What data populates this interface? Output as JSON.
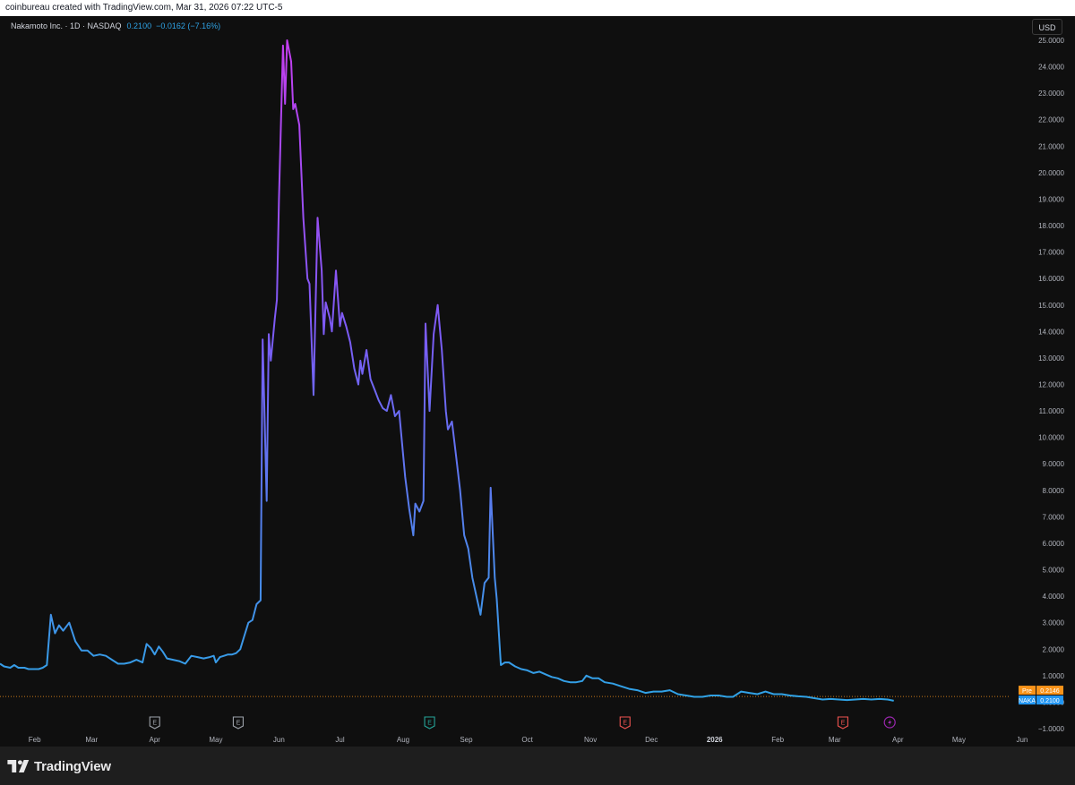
{
  "header": {
    "caption": "coinbureau created with TradingView.com, Mar 31, 2026 07:22 UTC-5"
  },
  "legend": {
    "symbol": "Nakamoto Inc. · 1D · NASDAQ",
    "last": "0.2100",
    "change": "−0.0162 (−7.16%)"
  },
  "currency_button": "USD",
  "price_tags": {
    "pre_label": "Pre",
    "pre_value": "0.2146",
    "pre_color": "#f7931a",
    "ticker_label": "NAKA",
    "ticker_value": "0.2100",
    "ticker_color": "#2196f3"
  },
  "colors": {
    "background": "#0f0f0f",
    "line_low": "#2fa3e5",
    "line_high": "#c43ef0",
    "prepost_line": "#f7931a"
  },
  "events": [
    {
      "date": "2025-04-01",
      "icon": "earnings-icon",
      "label": "E",
      "color": "#9ea3ab"
    },
    {
      "date": "2025-05-12",
      "icon": "earnings-icon",
      "label": "E",
      "color": "#9ea3ab"
    },
    {
      "date": "2025-08-14",
      "icon": "earnings-icon",
      "label": "E",
      "color": "#26a69a"
    },
    {
      "date": "2025-11-18",
      "icon": "earnings-icon",
      "label": "E",
      "color": "#ef5350"
    },
    {
      "date": "2026-03-05",
      "icon": "earnings-icon",
      "label": "E",
      "color": "#ef5350"
    },
    {
      "date": "2026-03-28",
      "icon": "lightning-icon",
      "label": "",
      "color": "#9c27b0"
    }
  ],
  "footer": {
    "brand": "TradingView"
  },
  "chart_data": {
    "type": "line",
    "title": "",
    "xlabel": "",
    "ylabel": "",
    "currency": "USD",
    "x_range": [
      "2025-01-15",
      "2026-06-05"
    ],
    "ylim": [
      -1.0,
      25.0
    ],
    "y_ticks": [
      -1,
      0,
      1,
      2,
      3,
      4,
      5,
      6,
      7,
      8,
      9,
      10,
      11,
      12,
      13,
      14,
      15,
      16,
      17,
      18,
      19,
      20,
      21,
      22,
      23,
      24,
      25
    ],
    "y_tick_labels": [
      "−1.0000",
      "0.0000",
      "1.0000",
      "2.0000",
      "3.0000",
      "4.0000",
      "5.0000",
      "6.0000",
      "7.0000",
      "8.0000",
      "9.0000",
      "10.0000",
      "11.0000",
      "12.0000",
      "13.0000",
      "14.0000",
      "15.0000",
      "16.0000",
      "17.0000",
      "18.0000",
      "19.0000",
      "20.0000",
      "21.0000",
      "22.0000",
      "23.0000",
      "24.0000",
      "25.0000"
    ],
    "x_ticks": [
      {
        "date": "2025-02-01",
        "label": "Feb",
        "bold": false
      },
      {
        "date": "2025-03-01",
        "label": "Mar",
        "bold": false
      },
      {
        "date": "2025-04-01",
        "label": "Apr",
        "bold": false
      },
      {
        "date": "2025-05-01",
        "label": "May",
        "bold": false
      },
      {
        "date": "2025-06-01",
        "label": "Jun",
        "bold": false
      },
      {
        "date": "2025-07-01",
        "label": "Jul",
        "bold": false
      },
      {
        "date": "2025-08-01",
        "label": "Aug",
        "bold": false
      },
      {
        "date": "2025-09-01",
        "label": "Sep",
        "bold": false
      },
      {
        "date": "2025-10-01",
        "label": "Oct",
        "bold": false
      },
      {
        "date": "2025-11-01",
        "label": "Nov",
        "bold": false
      },
      {
        "date": "2025-12-01",
        "label": "Dec",
        "bold": false
      },
      {
        "date": "2026-01-01",
        "label": "2026",
        "bold": true
      },
      {
        "date": "2026-02-01",
        "label": "Feb",
        "bold": false
      },
      {
        "date": "2026-03-01",
        "label": "Mar",
        "bold": false
      },
      {
        "date": "2026-04-01",
        "label": "Apr",
        "bold": false
      },
      {
        "date": "2026-05-01",
        "label": "May",
        "bold": false
      },
      {
        "date": "2026-06-01",
        "label": "Jun",
        "bold": false
      }
    ],
    "series": [
      {
        "points": [
          [
            "2025-01-15",
            1.45
          ],
          [
            "2025-01-17",
            1.35
          ],
          [
            "2025-01-20",
            1.3
          ],
          [
            "2025-01-22",
            1.4
          ],
          [
            "2025-01-24",
            1.3
          ],
          [
            "2025-01-27",
            1.3
          ],
          [
            "2025-01-29",
            1.25
          ],
          [
            "2025-01-31",
            1.25
          ],
          [
            "2025-02-03",
            1.25
          ],
          [
            "2025-02-05",
            1.3
          ],
          [
            "2025-02-07",
            1.4
          ],
          [
            "2025-02-09",
            3.3
          ],
          [
            "2025-02-11",
            2.6
          ],
          [
            "2025-02-13",
            2.9
          ],
          [
            "2025-02-15",
            2.7
          ],
          [
            "2025-02-18",
            3.0
          ],
          [
            "2025-02-21",
            2.3
          ],
          [
            "2025-02-24",
            1.95
          ],
          [
            "2025-02-27",
            1.95
          ],
          [
            "2025-03-02",
            1.75
          ],
          [
            "2025-03-05",
            1.8
          ],
          [
            "2025-03-08",
            1.75
          ],
          [
            "2025-03-11",
            1.6
          ],
          [
            "2025-03-14",
            1.45
          ],
          [
            "2025-03-17",
            1.45
          ],
          [
            "2025-03-20",
            1.5
          ],
          [
            "2025-03-23",
            1.6
          ],
          [
            "2025-03-26",
            1.5
          ],
          [
            "2025-03-28",
            2.2
          ],
          [
            "2025-03-30",
            2.05
          ],
          [
            "2025-04-01",
            1.8
          ],
          [
            "2025-04-03",
            2.1
          ],
          [
            "2025-04-05",
            1.9
          ],
          [
            "2025-04-07",
            1.65
          ],
          [
            "2025-04-10",
            1.6
          ],
          [
            "2025-04-13",
            1.55
          ],
          [
            "2025-04-16",
            1.45
          ],
          [
            "2025-04-19",
            1.75
          ],
          [
            "2025-04-22",
            1.7
          ],
          [
            "2025-04-25",
            1.65
          ],
          [
            "2025-04-28",
            1.7
          ],
          [
            "2025-04-30",
            1.75
          ],
          [
            "2025-05-01",
            1.5
          ],
          [
            "2025-05-03",
            1.7
          ],
          [
            "2025-05-05",
            1.75
          ],
          [
            "2025-05-07",
            1.8
          ],
          [
            "2025-05-09",
            1.8
          ],
          [
            "2025-05-11",
            1.85
          ],
          [
            "2025-05-13",
            2.0
          ],
          [
            "2025-05-15",
            2.5
          ],
          [
            "2025-05-17",
            3.0
          ],
          [
            "2025-05-19",
            3.1
          ],
          [
            "2025-05-21",
            3.7
          ],
          [
            "2025-05-23",
            3.85
          ],
          [
            "2025-05-24",
            13.7
          ],
          [
            "2025-05-26",
            7.6
          ],
          [
            "2025-05-27",
            13.9
          ],
          [
            "2025-05-28",
            12.9
          ],
          [
            "2025-05-30",
            14.5
          ],
          [
            "2025-05-31",
            15.2
          ],
          [
            "2025-06-01",
            19.0
          ],
          [
            "2025-06-03",
            24.8
          ],
          [
            "2025-06-04",
            22.6
          ],
          [
            "2025-06-05",
            25.0
          ],
          [
            "2025-06-07",
            24.2
          ],
          [
            "2025-06-08",
            22.4
          ],
          [
            "2025-06-09",
            22.6
          ],
          [
            "2025-06-11",
            21.8
          ],
          [
            "2025-06-13",
            18.3
          ],
          [
            "2025-06-15",
            16.0
          ],
          [
            "2025-06-16",
            15.8
          ],
          [
            "2025-06-18",
            11.6
          ],
          [
            "2025-06-20",
            18.3
          ],
          [
            "2025-06-22",
            16.3
          ],
          [
            "2025-06-23",
            13.9
          ],
          [
            "2025-06-24",
            15.1
          ],
          [
            "2025-06-26",
            14.5
          ],
          [
            "2025-06-27",
            14.0
          ],
          [
            "2025-06-29",
            16.3
          ],
          [
            "2025-07-01",
            14.2
          ],
          [
            "2025-07-02",
            14.7
          ],
          [
            "2025-07-04",
            14.2
          ],
          [
            "2025-07-06",
            13.6
          ],
          [
            "2025-07-08",
            12.6
          ],
          [
            "2025-07-10",
            12.0
          ],
          [
            "2025-07-11",
            12.9
          ],
          [
            "2025-07-12",
            12.4
          ],
          [
            "2025-07-14",
            13.3
          ],
          [
            "2025-07-16",
            12.2
          ],
          [
            "2025-07-18",
            11.8
          ],
          [
            "2025-07-20",
            11.4
          ],
          [
            "2025-07-22",
            11.1
          ],
          [
            "2025-07-24",
            11.0
          ],
          [
            "2025-07-26",
            11.6
          ],
          [
            "2025-07-28",
            10.8
          ],
          [
            "2025-07-30",
            11.0
          ],
          [
            "2025-08-02",
            8.5
          ],
          [
            "2025-08-04",
            7.3
          ],
          [
            "2025-08-06",
            6.3
          ],
          [
            "2025-08-07",
            7.5
          ],
          [
            "2025-08-09",
            7.2
          ],
          [
            "2025-08-11",
            7.6
          ],
          [
            "2025-08-12",
            14.3
          ],
          [
            "2025-08-14",
            11.0
          ],
          [
            "2025-08-16",
            13.9
          ],
          [
            "2025-08-18",
            15.0
          ],
          [
            "2025-08-20",
            13.3
          ],
          [
            "2025-08-22",
            11.0
          ],
          [
            "2025-08-23",
            10.3
          ],
          [
            "2025-08-25",
            10.6
          ],
          [
            "2025-08-27",
            9.3
          ],
          [
            "2025-08-29",
            8.0
          ],
          [
            "2025-08-31",
            6.3
          ],
          [
            "2025-09-02",
            5.8
          ],
          [
            "2025-09-04",
            4.7
          ],
          [
            "2025-09-06",
            4.0
          ],
          [
            "2025-09-08",
            3.3
          ],
          [
            "2025-09-10",
            4.5
          ],
          [
            "2025-09-12",
            4.7
          ],
          [
            "2025-09-13",
            8.1
          ],
          [
            "2025-09-15",
            4.7
          ],
          [
            "2025-09-16",
            3.9
          ],
          [
            "2025-09-18",
            1.4
          ],
          [
            "2025-09-20",
            1.5
          ],
          [
            "2025-09-22",
            1.5
          ],
          [
            "2025-09-25",
            1.35
          ],
          [
            "2025-09-28",
            1.25
          ],
          [
            "2025-10-01",
            1.2
          ],
          [
            "2025-10-04",
            1.1
          ],
          [
            "2025-10-07",
            1.15
          ],
          [
            "2025-10-10",
            1.05
          ],
          [
            "2025-10-13",
            0.95
          ],
          [
            "2025-10-16",
            0.9
          ],
          [
            "2025-10-19",
            0.8
          ],
          [
            "2025-10-22",
            0.75
          ],
          [
            "2025-10-25",
            0.75
          ],
          [
            "2025-10-28",
            0.8
          ],
          [
            "2025-10-30",
            1.0
          ],
          [
            "2025-11-02",
            0.9
          ],
          [
            "2025-11-05",
            0.9
          ],
          [
            "2025-11-08",
            0.75
          ],
          [
            "2025-11-12",
            0.7
          ],
          [
            "2025-11-16",
            0.6
          ],
          [
            "2025-11-20",
            0.5
          ],
          [
            "2025-11-24",
            0.45
          ],
          [
            "2025-11-28",
            0.35
          ],
          [
            "2025-12-02",
            0.4
          ],
          [
            "2025-12-06",
            0.4
          ],
          [
            "2025-12-10",
            0.45
          ],
          [
            "2025-12-14",
            0.3
          ],
          [
            "2025-12-18",
            0.25
          ],
          [
            "2025-12-22",
            0.2
          ],
          [
            "2025-12-26",
            0.2
          ],
          [
            "2025-12-30",
            0.25
          ],
          [
            "2026-01-03",
            0.25
          ],
          [
            "2026-01-07",
            0.2
          ],
          [
            "2026-01-10",
            0.2
          ],
          [
            "2026-01-14",
            0.4
          ],
          [
            "2026-01-18",
            0.35
          ],
          [
            "2026-01-22",
            0.3
          ],
          [
            "2026-01-26",
            0.4
          ],
          [
            "2026-01-30",
            0.3
          ],
          [
            "2026-02-03",
            0.3
          ],
          [
            "2026-02-07",
            0.25
          ],
          [
            "2026-02-11",
            0.22
          ],
          [
            "2026-02-15",
            0.2
          ],
          [
            "2026-02-19",
            0.15
          ],
          [
            "2026-02-23",
            0.1
          ],
          [
            "2026-02-27",
            0.12
          ],
          [
            "2026-03-03",
            0.1
          ],
          [
            "2026-03-07",
            0.08
          ],
          [
            "2026-03-11",
            0.1
          ],
          [
            "2026-03-15",
            0.12
          ],
          [
            "2026-03-19",
            0.1
          ],
          [
            "2026-03-23",
            0.12
          ],
          [
            "2026-03-27",
            0.1
          ],
          [
            "2026-03-30",
            0.05
          ]
        ]
      }
    ],
    "reference_lines": [
      {
        "y": 0.2146
      }
    ],
    "grid": false,
    "legend_position": "top-left"
  }
}
